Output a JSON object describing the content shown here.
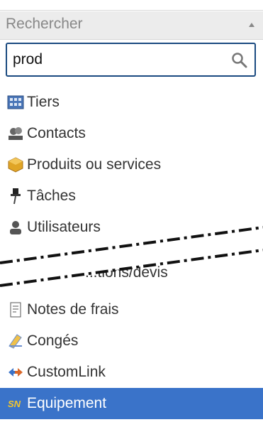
{
  "header": {
    "title": "Rechercher"
  },
  "search": {
    "value": "prod",
    "icon": "search-icon"
  },
  "menu": {
    "items": [
      {
        "label": "Tiers",
        "icon": "building-icon"
      },
      {
        "label": "Contacts",
        "icon": "contacts-icon"
      },
      {
        "label": "Produits ou services",
        "icon": "product-cube-icon"
      },
      {
        "label": "Tâches",
        "icon": "pin-icon"
      },
      {
        "label": "Utilisateurs",
        "icon": "user-icon"
      },
      {
        "label": "...tions/devis",
        "icon": "document-icon"
      },
      {
        "label": "Notes de frais",
        "icon": "receipt-icon"
      },
      {
        "label": "Congés",
        "icon": "deckchair-icon"
      },
      {
        "label": "CustomLink",
        "icon": "link-arrows-icon"
      },
      {
        "label": "Equipement",
        "icon": "sn-icon",
        "selected": true
      }
    ]
  },
  "colors": {
    "selection": "#3a73c9",
    "border": "#1a4a80",
    "header": "#ececec"
  }
}
